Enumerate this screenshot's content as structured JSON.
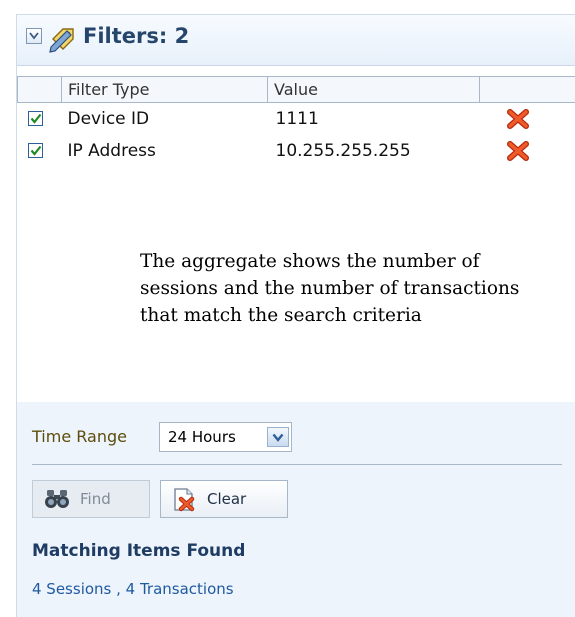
{
  "filters_panel": {
    "title": "Filters: 2",
    "icons": {
      "collapse": "collapse-toggle-icon",
      "header": "tag-pencil-icon"
    }
  },
  "filter_table": {
    "columns": [
      "Filter Type",
      "Value",
      ""
    ],
    "rows": [
      {
        "checked": true,
        "type": "Device ID",
        "value": "1111",
        "delete_icon": "red-x-delete-icon"
      },
      {
        "checked": true,
        "type": "IP Address",
        "value": "10.255.255.255",
        "delete_icon": "red-x-delete-icon"
      }
    ]
  },
  "annotation": "The aggregate shows the number of sessions and the number of transactions that match the search criteria",
  "time_range": {
    "label": "Time Range",
    "selected": "24 Hours"
  },
  "buttons": {
    "find": {
      "label": "Find",
      "icon": "binoculars-icon",
      "enabled": false
    },
    "clear": {
      "label": "Clear",
      "icon": "clear-document-icon",
      "enabled": true
    }
  },
  "results": {
    "title": "Matching Items Found",
    "value": "4 Sessions , 4 Transactions"
  },
  "colors": {
    "panel_background": "#eef4fb",
    "title_text": "#26456b",
    "result_link": "#1e5aa0",
    "delete_red": "#e03a17"
  }
}
